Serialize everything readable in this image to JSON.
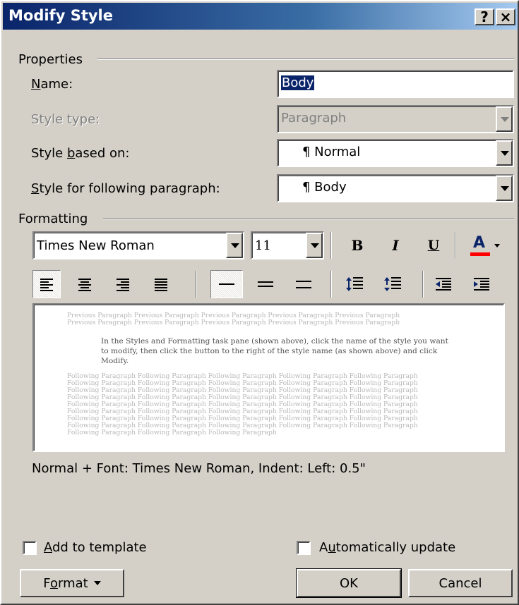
{
  "window": {
    "title": "Modify Style",
    "help_label": "?",
    "close_label": "×"
  },
  "properties": {
    "group_label": "Properties",
    "name_label": "Name:",
    "name_value": "Body",
    "style_type_label": "Style type:",
    "style_type_value": "Paragraph",
    "based_on_label": "Style based on:",
    "based_on_value": "¶ Normal",
    "following_label": "Style for following paragraph:",
    "following_value": "¶ Body"
  },
  "formatting": {
    "group_label": "Formatting",
    "font_name": "Times New Roman",
    "font_size": "11",
    "bold_label": "B",
    "italic_label": "I",
    "underline_label": "U",
    "font_color_label": "A",
    "font_color": "#ff0000"
  },
  "preview": {
    "previous_lines": [
      "Previous Paragraph Previous Paragraph Previous Paragraph Previous Paragraph Previous Paragraph",
      "Previous Paragraph Previous Paragraph Previous Paragraph Previous Paragraph Previous Paragraph"
    ],
    "sample_text": "In the Styles and Formatting task pane (shown above), click the name of the style you want to modify, then click the button to the right of the style name (as shown above) and click Modify.",
    "following_lines": [
      "Following Paragraph Following Paragraph Following Paragraph Following Paragraph Following Paragraph",
      "Following Paragraph Following Paragraph Following Paragraph Following Paragraph Following Paragraph",
      "Following Paragraph Following Paragraph Following Paragraph Following Paragraph Following Paragraph",
      "Following Paragraph Following Paragraph Following Paragraph Following Paragraph Following Paragraph",
      "Following Paragraph Following Paragraph Following Paragraph Following Paragraph Following Paragraph",
      "Following Paragraph Following Paragraph Following Paragraph Following Paragraph Following Paragraph",
      "Following Paragraph Following Paragraph Following Paragraph Following Paragraph Following Paragraph",
      "Following Paragraph Following Paragraph Following Paragraph Following Paragraph Following Paragraph",
      "Following Paragraph Following Paragraph Following Paragraph"
    ]
  },
  "description": "Normal + Font: Times New Roman, Indent: Left:  0.5\"",
  "options": {
    "add_to_template_label": "Add to template",
    "auto_update_label": "Automatically update"
  },
  "buttons": {
    "format_label": "Format",
    "ok_label": "OK",
    "cancel_label": "Cancel"
  }
}
